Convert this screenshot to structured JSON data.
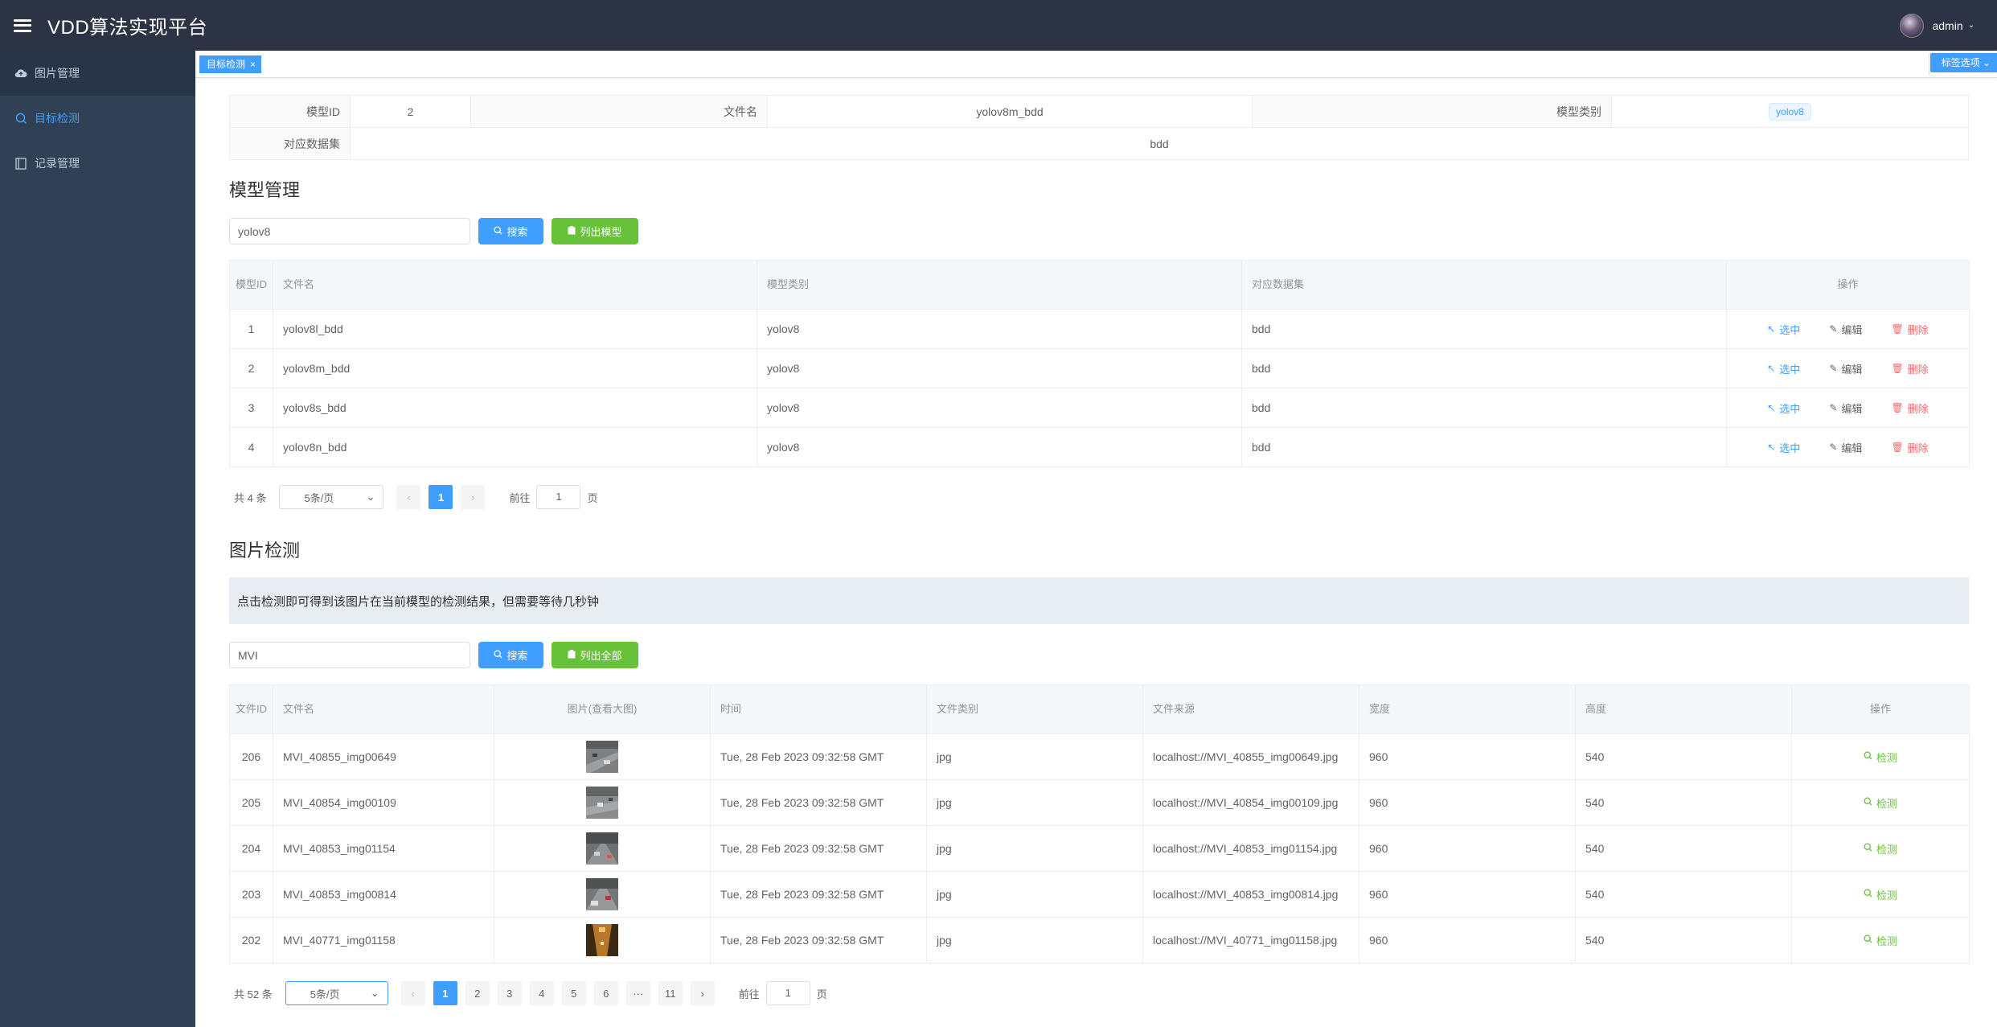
{
  "header": {
    "title": "VDD算法实现平台",
    "user": "admin"
  },
  "sidebar": {
    "items": [
      {
        "label": "图片管理",
        "icon": "cloud-upload-icon"
      },
      {
        "label": "目标检测",
        "icon": "search-icon"
      },
      {
        "label": "记录管理",
        "icon": "notebook-icon"
      }
    ]
  },
  "tags": {
    "active_tag": "目标检测",
    "options_label": "标签选项"
  },
  "current_model": {
    "labels": {
      "id": "模型ID",
      "file": "文件名",
      "category": "模型类别",
      "dataset": "对应数据集"
    },
    "id": "2",
    "file": "yolov8m_bdd",
    "category": "yolov8",
    "dataset": "bdd"
  },
  "model_section": {
    "title": "模型管理",
    "search_value": "yolov8",
    "search_button": "搜索",
    "list_button": "列出模型",
    "columns": [
      "模型ID",
      "文件名",
      "模型类别",
      "对应数据集",
      "操作"
    ],
    "rows": [
      {
        "id": "1",
        "file": "yolov8l_bdd",
        "category": "yolov8",
        "dataset": "bdd"
      },
      {
        "id": "2",
        "file": "yolov8m_bdd",
        "category": "yolov8",
        "dataset": "bdd"
      },
      {
        "id": "3",
        "file": "yolov8s_bdd",
        "category": "yolov8",
        "dataset": "bdd"
      },
      {
        "id": "4",
        "file": "yolov8n_bdd",
        "category": "yolov8",
        "dataset": "bdd"
      }
    ],
    "actions": {
      "select": "选中",
      "edit": "编辑",
      "delete": "删除"
    },
    "pager": {
      "total": "共 4 条",
      "size": "5条/页",
      "current": "1",
      "goto": "前往",
      "goto_value": "1",
      "page_unit": "页"
    }
  },
  "image_section": {
    "title": "图片检测",
    "info": "点击检测即可得到该图片在当前模型的检测结果，但需要等待几秒钟",
    "search_value": "MVI",
    "search_button": "搜索",
    "list_button": "列出全部",
    "columns": [
      "文件ID",
      "文件名",
      "图片(查看大图)",
      "时间",
      "文件类别",
      "文件来源",
      "宽度",
      "高度",
      "操作"
    ],
    "rows": [
      {
        "id": "206",
        "file": "MVI_40855_img00649",
        "time": "Tue, 28 Feb 2023 09:32:58 GMT",
        "type": "jpg",
        "source": "localhost://MVI_40855_img00649.jpg",
        "width": "960",
        "height": "540"
      },
      {
        "id": "205",
        "file": "MVI_40854_img00109",
        "time": "Tue, 28 Feb 2023 09:32:58 GMT",
        "type": "jpg",
        "source": "localhost://MVI_40854_img00109.jpg",
        "width": "960",
        "height": "540"
      },
      {
        "id": "204",
        "file": "MVI_40853_img01154",
        "time": "Tue, 28 Feb 2023 09:32:58 GMT",
        "type": "jpg",
        "source": "localhost://MVI_40853_img01154.jpg",
        "width": "960",
        "height": "540"
      },
      {
        "id": "203",
        "file": "MVI_40853_img00814",
        "time": "Tue, 28 Feb 2023 09:32:58 GMT",
        "type": "jpg",
        "source": "localhost://MVI_40853_img00814.jpg",
        "width": "960",
        "height": "540"
      },
      {
        "id": "202",
        "file": "MVI_40771_img01158",
        "time": "Tue, 28 Feb 2023 09:32:58 GMT",
        "type": "jpg",
        "source": "localhost://MVI_40771_img01158.jpg",
        "width": "960",
        "height": "540"
      }
    ],
    "action": "检测",
    "pager": {
      "total": "共 52 条",
      "size": "5条/页",
      "pages": [
        "1",
        "2",
        "3",
        "4",
        "5",
        "6",
        "···",
        "11"
      ],
      "current": "1",
      "goto": "前往",
      "goto_value": "1",
      "page_unit": "页"
    }
  }
}
